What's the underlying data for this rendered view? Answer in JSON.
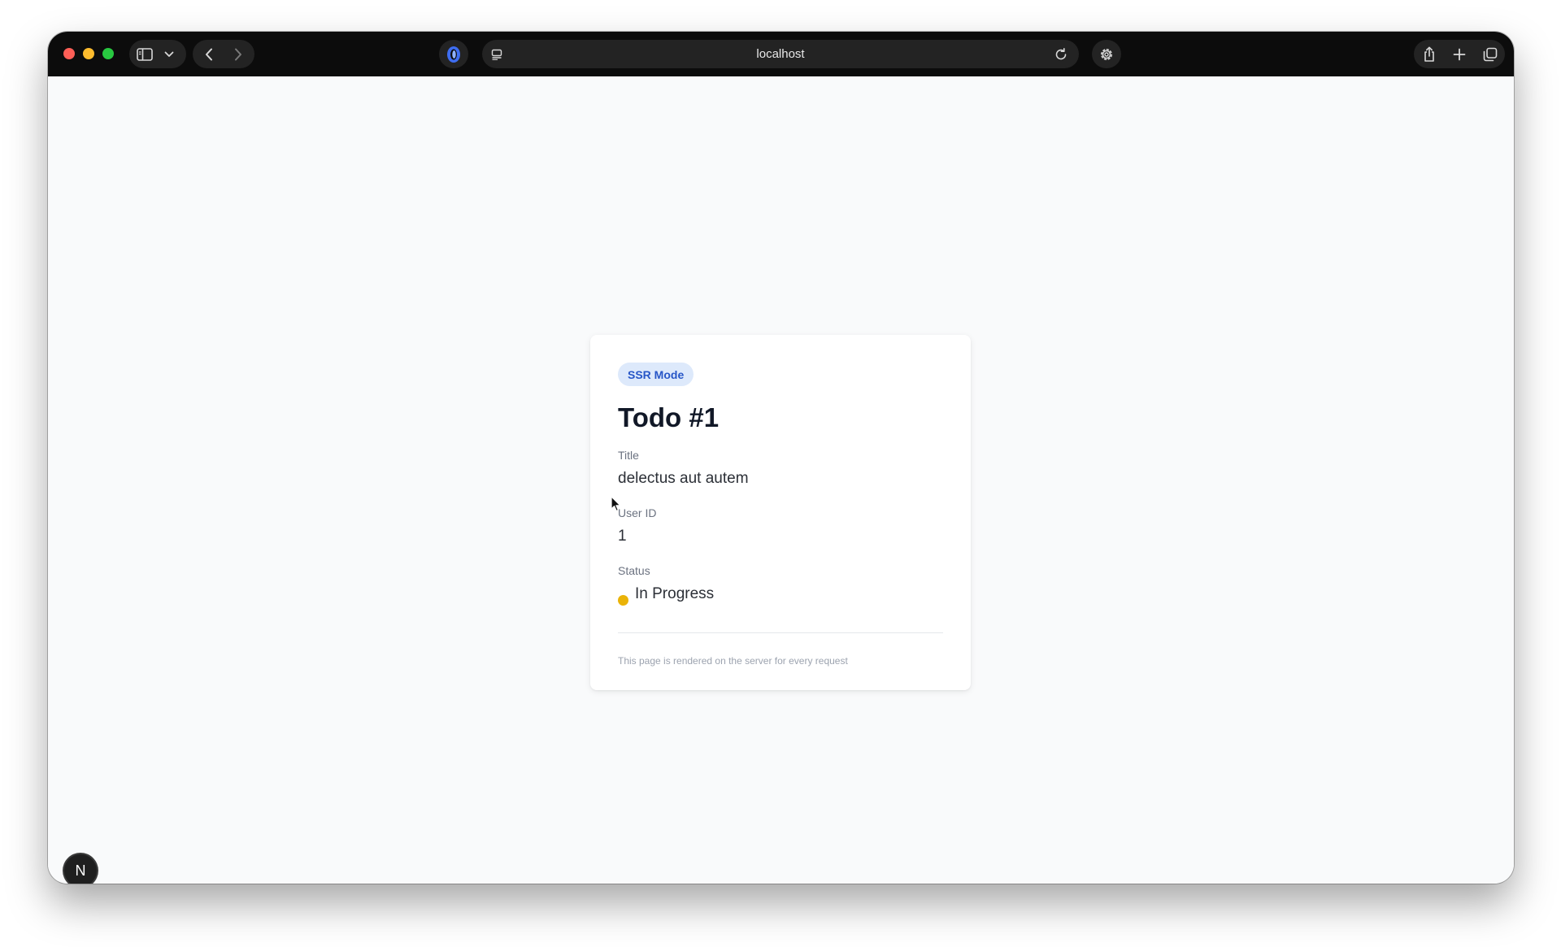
{
  "browser": {
    "url": "localhost",
    "icons": {
      "sidebar": "sidebar-icon",
      "chevron": "chevron-down-icon",
      "back": "chevron-left-icon",
      "forward": "chevron-right-icon",
      "extension": "shield-icon",
      "page_menu": "page-menu-icon",
      "reload": "reload-icon",
      "settings": "gear-icon",
      "share": "share-icon",
      "new_tab": "plus-icon",
      "tabs": "tabs-overview-icon"
    }
  },
  "card": {
    "badge": "SSR Mode",
    "title": "Todo #1",
    "fields": [
      {
        "label": "Title",
        "value": "delectus aut autem"
      },
      {
        "label": "User ID",
        "value": "1"
      },
      {
        "label": "Status",
        "value": "In Progress"
      }
    ],
    "footnote": "This page is rendered on the server for every request"
  },
  "colors": {
    "badge_bg": "#dde9fb",
    "badge_text": "#2756c7",
    "status_in_progress": "#eab308"
  },
  "dev_indicator": {
    "label": "N"
  }
}
